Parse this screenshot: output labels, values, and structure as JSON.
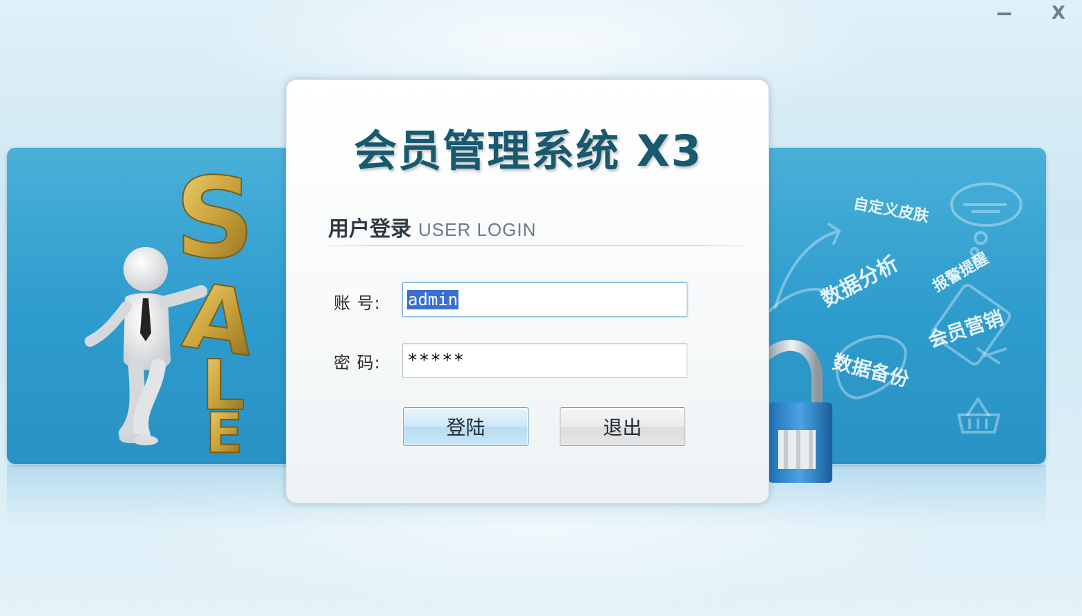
{
  "window": {
    "minimize_icon": "minimize-icon",
    "close_icon": "close-icon",
    "close_glyph": "X"
  },
  "login": {
    "app_title": "会员管理系统 X3",
    "section_title_cn": "用户登录",
    "section_title_en": "USER LOGIN",
    "account_label": "账  号:",
    "account_value": "admin",
    "password_label": "密  码:",
    "password_value": "*****",
    "login_button": "登陆",
    "exit_button": "退出"
  },
  "banner": {
    "sale_letters": [
      "S",
      "A",
      "L",
      "E"
    ],
    "features": [
      "自定义皮肤",
      "数据分析",
      "报警提醒",
      "会员营销",
      "数据备份"
    ]
  },
  "colors": {
    "banner_blue": "#2d9bcd",
    "title_teal": "#17596f",
    "sale_gold": "#c9a23a"
  }
}
